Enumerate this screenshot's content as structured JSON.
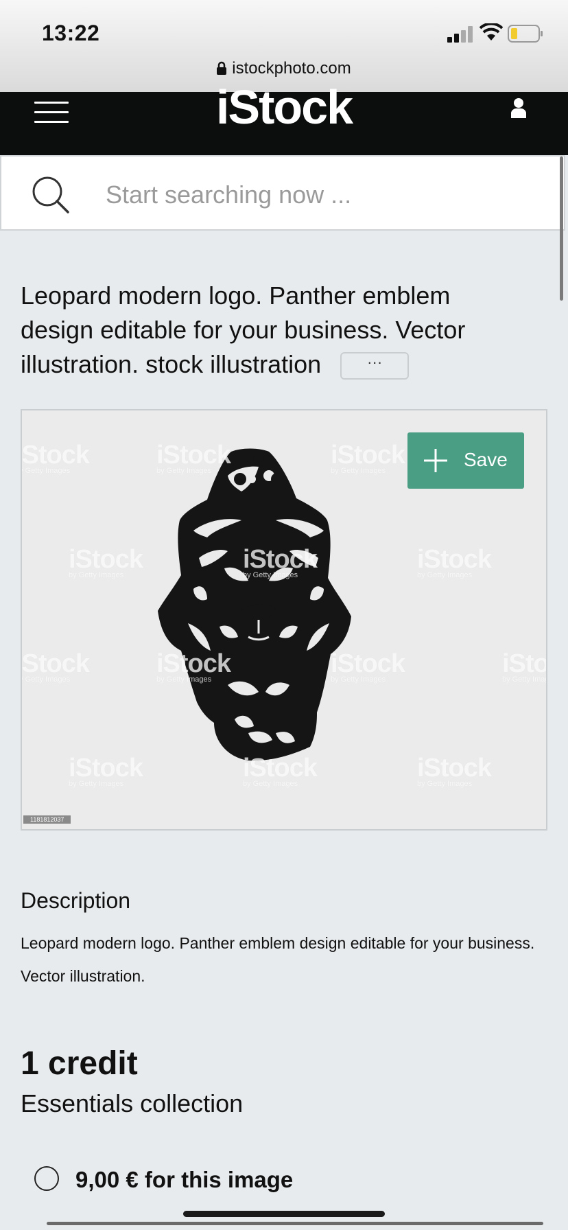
{
  "status": {
    "time": "13:22",
    "url": "istockphoto.com"
  },
  "header": {
    "logo": "iStock"
  },
  "search": {
    "placeholder": "Start searching now ..."
  },
  "asset": {
    "title": "Leopard modern logo. Panther emblem design editable for your business. Vector illustration. stock illustration",
    "more_label": "···",
    "save_label": "Save",
    "image_id": "1181812037",
    "watermark": "iStock",
    "watermark_sub": "by Getty Images"
  },
  "description": {
    "heading": "Description",
    "text": "Leopard modern logo. Panther emblem design editable for your business. Vector illustration."
  },
  "pricing": {
    "credits": "1 credit",
    "collection": "Essentials collection",
    "option_label": "9,00 € for this image"
  },
  "colors": {
    "accent": "#4a9e84",
    "header": "#0c0d0d",
    "background": "#e8ebed"
  },
  "icons": [
    "lock-icon",
    "menu-icon",
    "user-icon",
    "search-icon",
    "plus-icon",
    "signal-icon",
    "wifi-icon",
    "battery-icon"
  ]
}
